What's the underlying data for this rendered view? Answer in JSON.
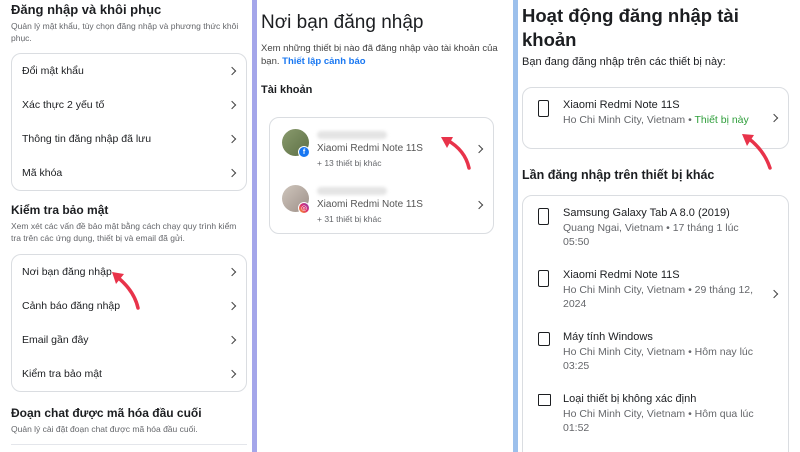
{
  "panel1": {
    "login_heading": "Đăng nhập và khôi phục",
    "login_desc": "Quản lý mật khẩu, tùy chọn đăng nhập và phương thức khôi phục.",
    "login_items": [
      "Đổi mật khẩu",
      "Xác thực 2 yếu tố",
      "Thông tin đăng nhập đã lưu",
      "Mã khóa"
    ],
    "security_heading": "Kiểm tra bảo mật",
    "security_desc": "Xem xét các vấn đề bảo mật bằng cách chạy quy trình kiểm tra trên các ứng dụng, thiết bị và email đã gửi.",
    "security_items": [
      "Nơi bạn đăng nhập",
      "Cảnh báo đăng nhập",
      "Email gần đây",
      "Kiểm tra bảo mật"
    ],
    "e2e_heading": "Đoạn chat được mã hóa đầu cuối",
    "e2e_desc": "Quản lý cài đặt đoạn chat được mã hóa đầu cuối."
  },
  "panel2": {
    "title": "Nơi bạn đăng nhập",
    "desc": "Xem những thiết bị nào đã đăng nhập vào tài khoản của bạn.",
    "link": "Thiết lập cảnh báo",
    "accounts_label": "Tài khoản",
    "accounts": [
      {
        "device": "Xiaomi Redmi Note 11S",
        "more": "+ 13 thiết bị khác",
        "app_icon": "facebook-icon"
      },
      {
        "device": "Xiaomi Redmi Note 11S",
        "more": "+ 31 thiết bị khác",
        "app_icon": "instagram-icon"
      }
    ]
  },
  "panel3": {
    "title": "Hoạt động đăng nhập tài khoản",
    "current_label": "Bạn đang đăng nhập trên các thiết bị này:",
    "current": {
      "device": "Xiaomi Redmi Note 11S",
      "location": "Ho Chi Minh City, Vietnam •",
      "status": "Thiết bị này"
    },
    "other_label": "Lần đăng nhập trên thiết bị khác",
    "others": [
      {
        "device": "Samsung Galaxy Tab A 8.0 (2019)",
        "meta": "Quang Ngai, Vietnam • 17 tháng 1 lúc 05:50",
        "icon": "tablet-icon"
      },
      {
        "device": "Xiaomi Redmi Note 11S",
        "meta": "Ho Chi Minh City, Vietnam • 29 tháng 12, 2024",
        "icon": "phone-icon"
      },
      {
        "device": "Máy tính Windows",
        "meta": "Ho Chi Minh City, Vietnam • Hôm nay lúc 03:25",
        "icon": "computer-icon"
      },
      {
        "device": "Loại thiết bị không xác định",
        "meta": "Ho Chi Minh City, Vietnam • Hôm qua lúc 01:52",
        "icon": "unknown-device-icon"
      }
    ]
  },
  "colors": {
    "accent": "#1877f2",
    "arrow": "#e8334a",
    "green": "#2e9e3a",
    "divider1": "#a4a6ea",
    "divider2": "#9cc0ec"
  }
}
